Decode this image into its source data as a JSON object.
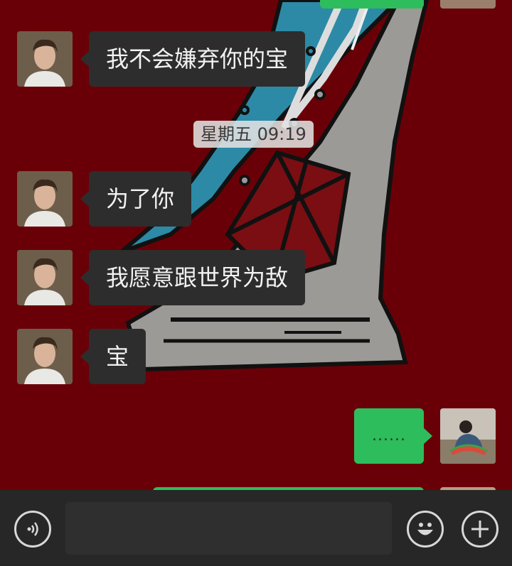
{
  "chat": {
    "messages": [
      {
        "side": "left",
        "text": "我不会嫌弃你的宝"
      },
      {
        "side": "left",
        "text": "为了你"
      },
      {
        "side": "left",
        "text": "我愿意跟世界为敌"
      },
      {
        "side": "left",
        "text": "宝"
      },
      {
        "side": "right",
        "text": "......"
      }
    ],
    "timestamp": "星期五 09:19"
  },
  "input_bar": {
    "voice_icon": "voice-icon",
    "emoji_icon": "emoji-icon",
    "plus_icon": "plus-icon",
    "input_value": ""
  },
  "colors": {
    "wallpaper": "#6a0007",
    "incoming_bubble": "#2d2d2d",
    "outgoing_bubble": "#2ebd5c",
    "input_bar": "#272727"
  }
}
